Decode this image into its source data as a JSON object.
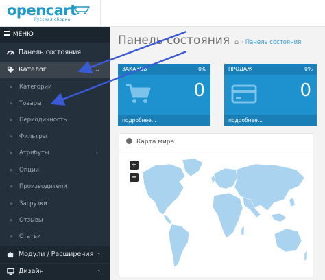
{
  "brand": {
    "name": "opencart",
    "tagline": "Русская сборка"
  },
  "sidebar": {
    "menu_label": "МЕНЮ",
    "items": [
      {
        "label": "Панель состояния",
        "icon": "dashboard-icon"
      },
      {
        "label": "Каталог",
        "icon": "tag-icon",
        "active": true
      },
      {
        "label": "Модули / Расширения",
        "icon": "puzzle-icon"
      },
      {
        "label": "Дизайн",
        "icon": "monitor-icon"
      }
    ],
    "subitems": [
      {
        "label": "Категории"
      },
      {
        "label": "Товары"
      },
      {
        "label": "Периодичность"
      },
      {
        "label": "Фильтры"
      },
      {
        "label": "Атрибуты"
      },
      {
        "label": "Опции"
      },
      {
        "label": "Производители"
      },
      {
        "label": "Загрузки"
      },
      {
        "label": "Отзывы"
      },
      {
        "label": "Статьи"
      }
    ]
  },
  "main": {
    "title": "Панель состояния",
    "breadcrumb": "Панель состояния",
    "tiles": [
      {
        "title": "ЗАКАЗОВ",
        "percent": "0%",
        "value": "0",
        "link": "подробнее...",
        "icon": "cart-icon"
      },
      {
        "title": "ПРОДАЖ",
        "percent": "0%",
        "value": "0",
        "link": "подробнее...",
        "icon": "credit-card-icon"
      }
    ],
    "map_panel": {
      "title": "Карта мира",
      "zoom_in": "+",
      "zoom_out": "−"
    }
  },
  "colors": {
    "sidebar_bg": "#24303c",
    "tile_bg": "#1e91cf",
    "map_land": "#a9d3ee",
    "arrow": "#3a5bd6"
  }
}
